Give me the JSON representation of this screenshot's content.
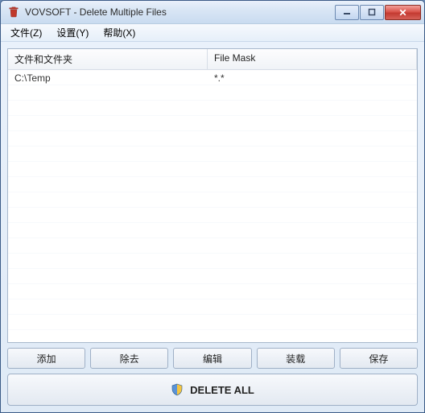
{
  "window": {
    "title": "VOVSOFT - Delete Multiple Files"
  },
  "menubar": {
    "file": "文件(Z)",
    "settings": "设置(Y)",
    "help": "帮助(X)"
  },
  "listview": {
    "header": {
      "path": "文件和文件夹",
      "mask": "File Mask"
    },
    "rows": [
      {
        "path": "C:\\Temp",
        "mask": "*.*"
      }
    ]
  },
  "buttons": {
    "add": "添加",
    "remove": "除去",
    "edit": "编辑",
    "load": "装载",
    "save": "保存",
    "delete_all": "DELETE ALL"
  }
}
